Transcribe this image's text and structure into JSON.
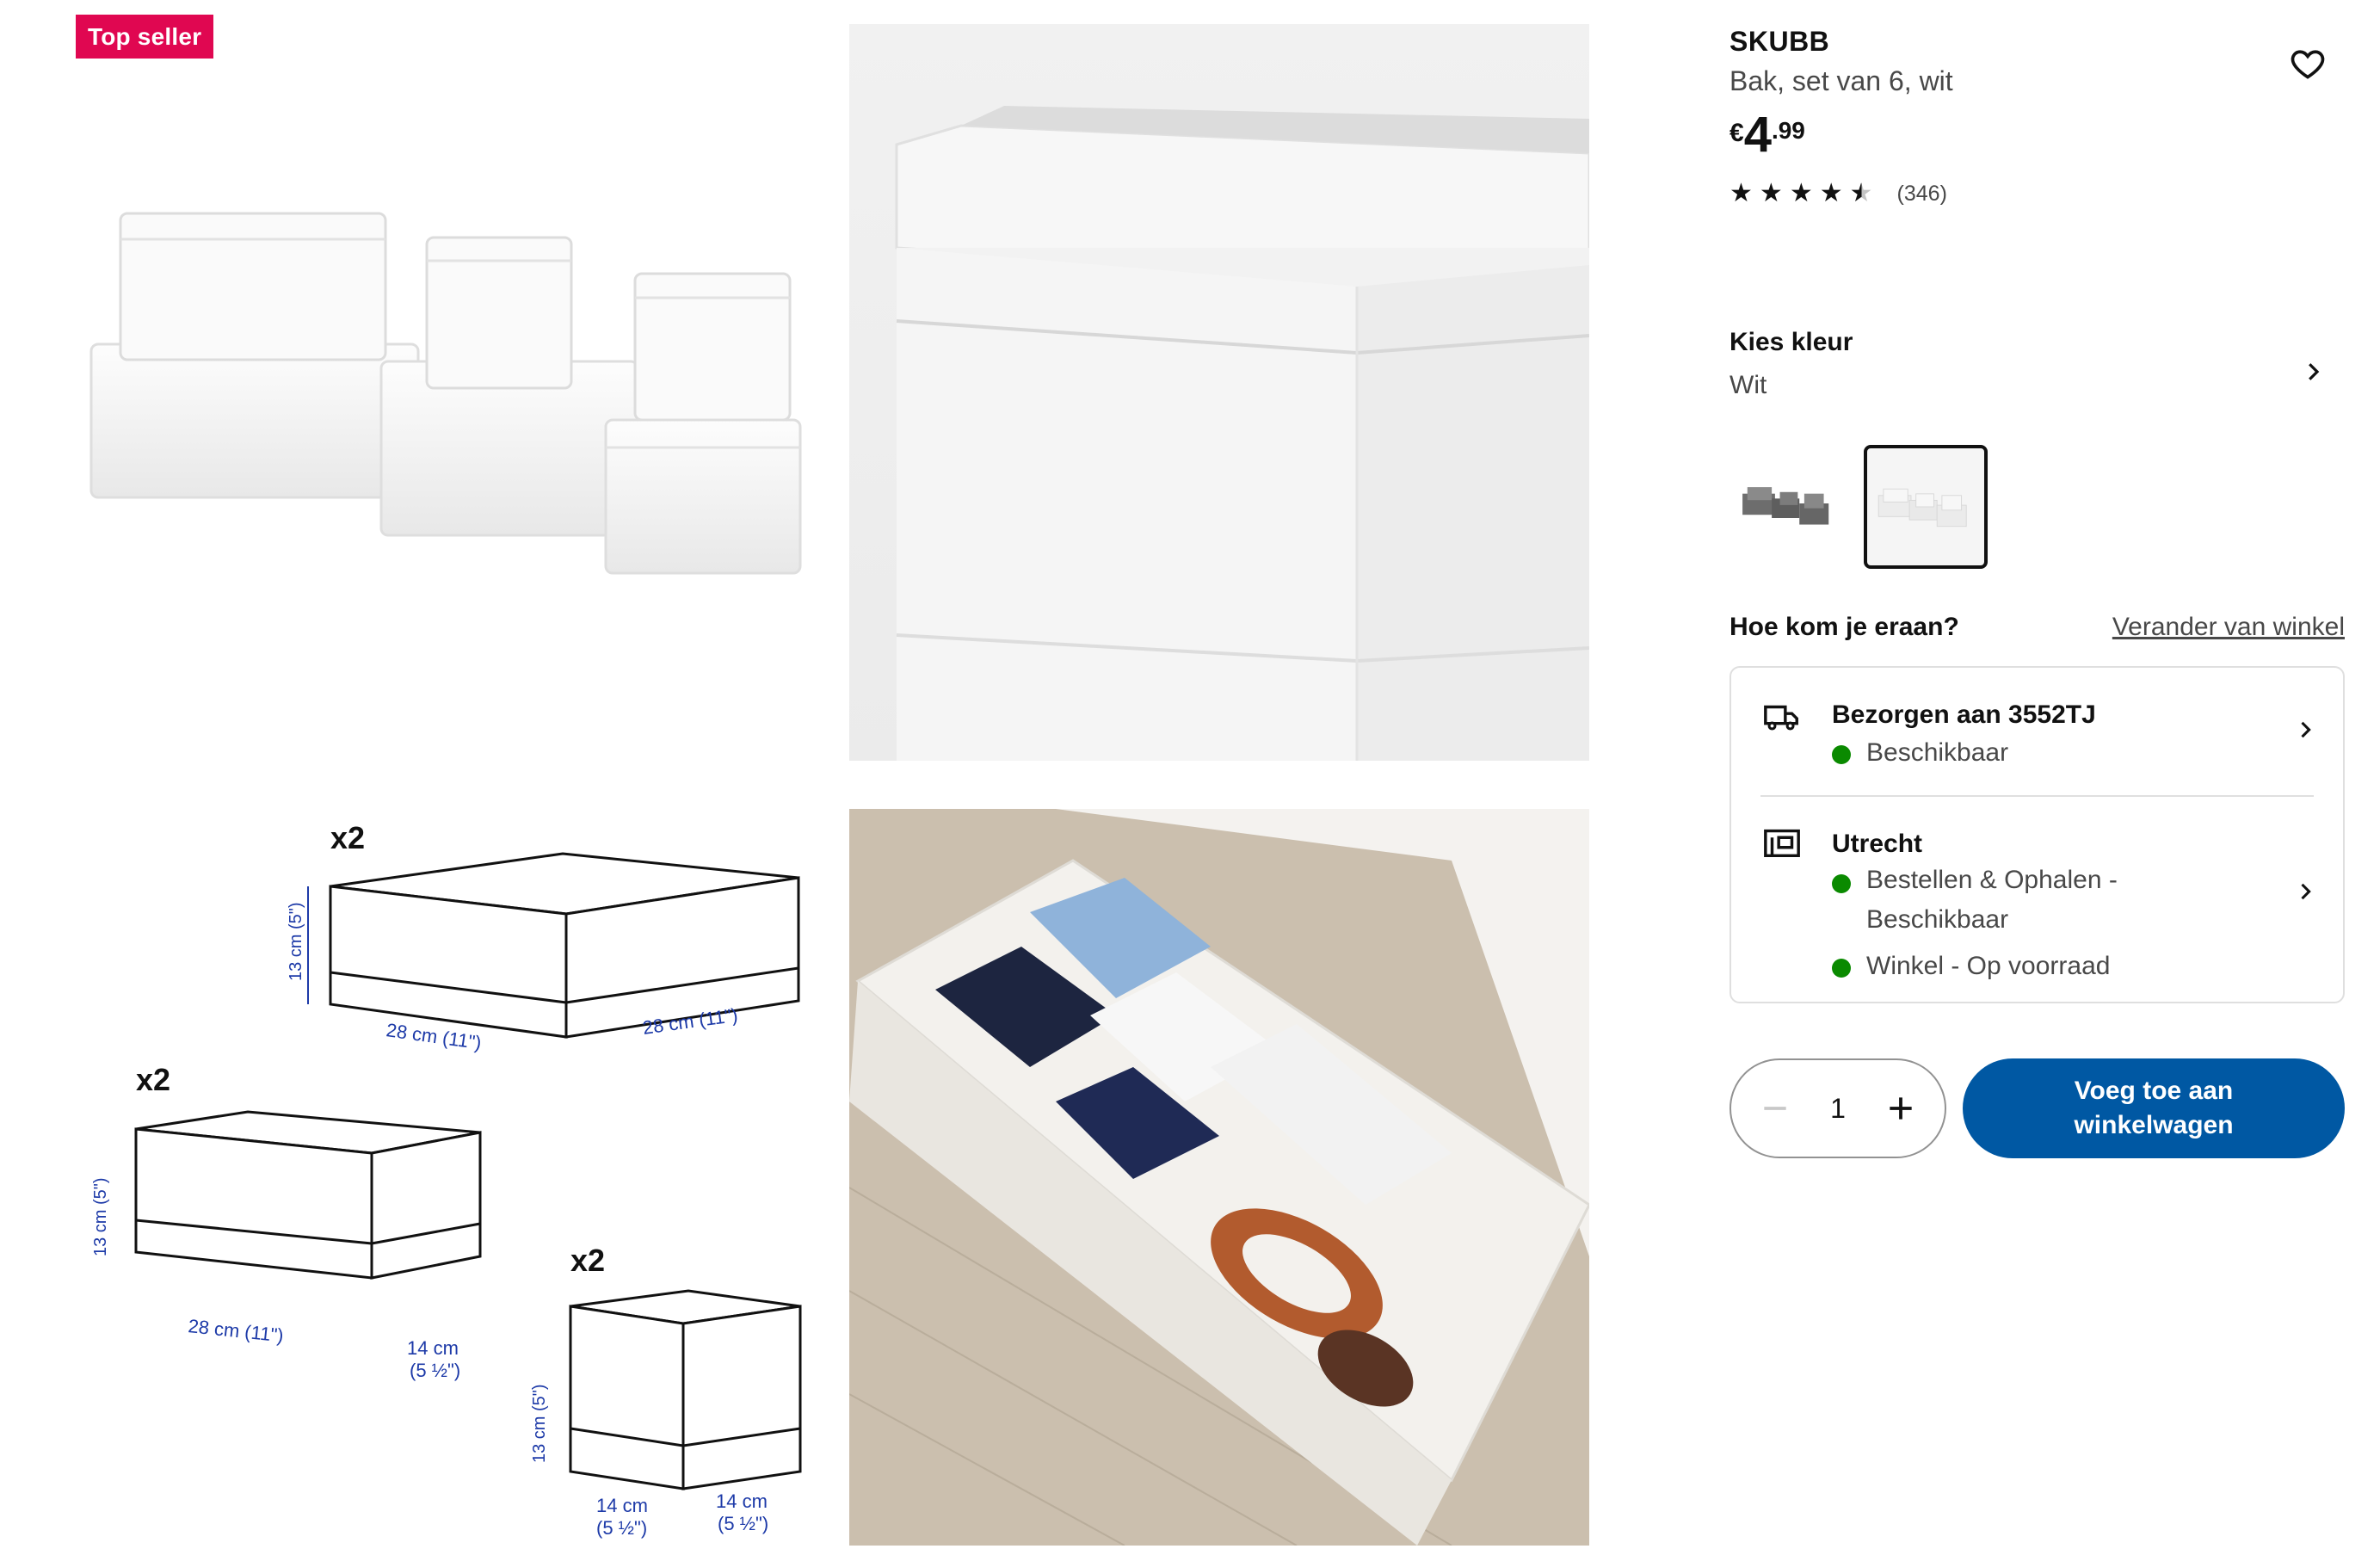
{
  "badge": "Top seller",
  "product": {
    "name": "SKUBB",
    "description": "Bak, set van 6, wit",
    "price": {
      "currency": "€",
      "integer": "4",
      "decimals": ".99"
    },
    "rating": {
      "stars": 4.5,
      "out_of": 5,
      "count": "(346)"
    }
  },
  "icons": {
    "favourite": "heart-icon",
    "chevron": "chevron-right-icon",
    "delivery": "truck-icon",
    "store": "store-icon",
    "minus": "minus-icon",
    "plus": "plus-icon"
  },
  "color": {
    "title": "Kies kleur",
    "selected": "Wit",
    "swatches": [
      "grey-swatch",
      "white-swatch"
    ]
  },
  "availability": {
    "title": "Hoe kom je eraan?",
    "change_store": "Verander van winkel",
    "delivery": {
      "title": "Bezorgen aan 3552TJ",
      "status": "Beschikbaar"
    },
    "store": {
      "title": "Utrecht",
      "line1a": "Bestellen & Ophalen -",
      "line1b": "Beschikbaar",
      "line2": "Winkel - Op voorraad"
    },
    "status_color": "#0a8a00"
  },
  "purchase": {
    "quantity": "1",
    "add_label_1": "Voeg toe aan",
    "add_label_2": "winkelwagen",
    "accent": "#0058a3"
  },
  "diagram": {
    "set_a": {
      "count": "x2",
      "height": "13 cm (5\")",
      "width": "28 cm (11\")",
      "depth": "28 cm (11\")"
    },
    "set_b": {
      "count": "x2",
      "height": "13 cm (5\")",
      "width": "28 cm (11\")",
      "depth_1": "14 cm",
      "depth_2": "(5 ½\")"
    },
    "set_c": {
      "count": "x2",
      "height": "13 cm (5\")",
      "width_1": "14 cm",
      "width_2": "(5 ½\")",
      "depth_1": "14 cm",
      "depth_2": "(5 ½\")"
    }
  },
  "brand_colors": {
    "badge": "#e00751",
    "dimension_text": "#1d3aa8"
  }
}
